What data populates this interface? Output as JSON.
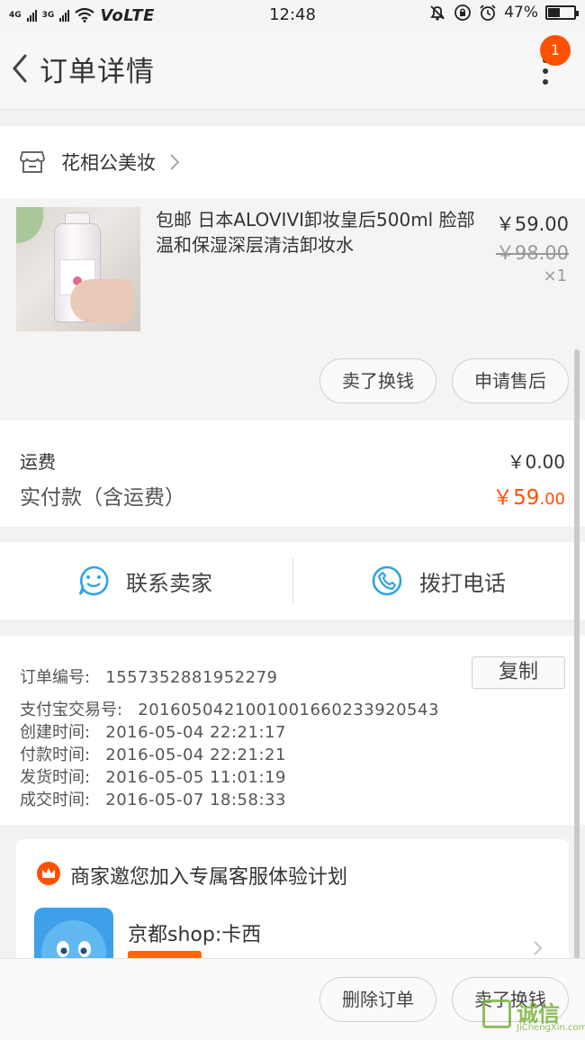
{
  "status_bar": {
    "net1": "4G",
    "net2": "3G",
    "volte": "VoLTE",
    "time": "12:48",
    "battery": "47%",
    "battery_level": 0.47
  },
  "header": {
    "title": "订单详情",
    "badge_count": "1"
  },
  "shop": {
    "name": "花相公美妆"
  },
  "item": {
    "title": "包邮 日本ALOVIVI卸妆皇后500ml 脸部温和保湿深层清洁卸妆水",
    "price": "￥59.00",
    "original_price": "￥98.00",
    "quantity": "×1",
    "btn_sell": "卖了换钱",
    "btn_aftersale": "申请售后"
  },
  "fees": {
    "shipping_label": "运费",
    "shipping_value": "￥0.00",
    "paid_label": "实付款（含运费）",
    "paid_value_main": "￥59",
    "paid_value_cents": ".00"
  },
  "contact": {
    "seller_label": "联系卖家",
    "phone_label": "拨打电话"
  },
  "order_info": {
    "copy_label": "复制",
    "rows": [
      {
        "key": "订单编号:",
        "value": "1557352881952279"
      },
      {
        "key": "支付宝交易号:",
        "value": "2016050421001001660233920543"
      },
      {
        "key": "创建时间:",
        "value": "2016-05-04 22:21:17"
      },
      {
        "key": "付款时间:",
        "value": "2016-05-04 22:21:21"
      },
      {
        "key": "发货时间:",
        "value": "2016-05-05 11:01:19"
      },
      {
        "key": "成交时间:",
        "value": "2016-05-07 18:58:33"
      }
    ]
  },
  "promo": {
    "title": "商家邀您加入专属客服体验计划",
    "shop_name": "京都shop:卡西"
  },
  "bottom_bar": {
    "delete_label": "删除订单",
    "sell_label": "卖了换钱"
  },
  "watermark": {
    "text": "诚信",
    "sub": "JiChengXin.com"
  },
  "colors": {
    "accent": "#ff5000",
    "phone_icon": "#2fa3e6"
  }
}
